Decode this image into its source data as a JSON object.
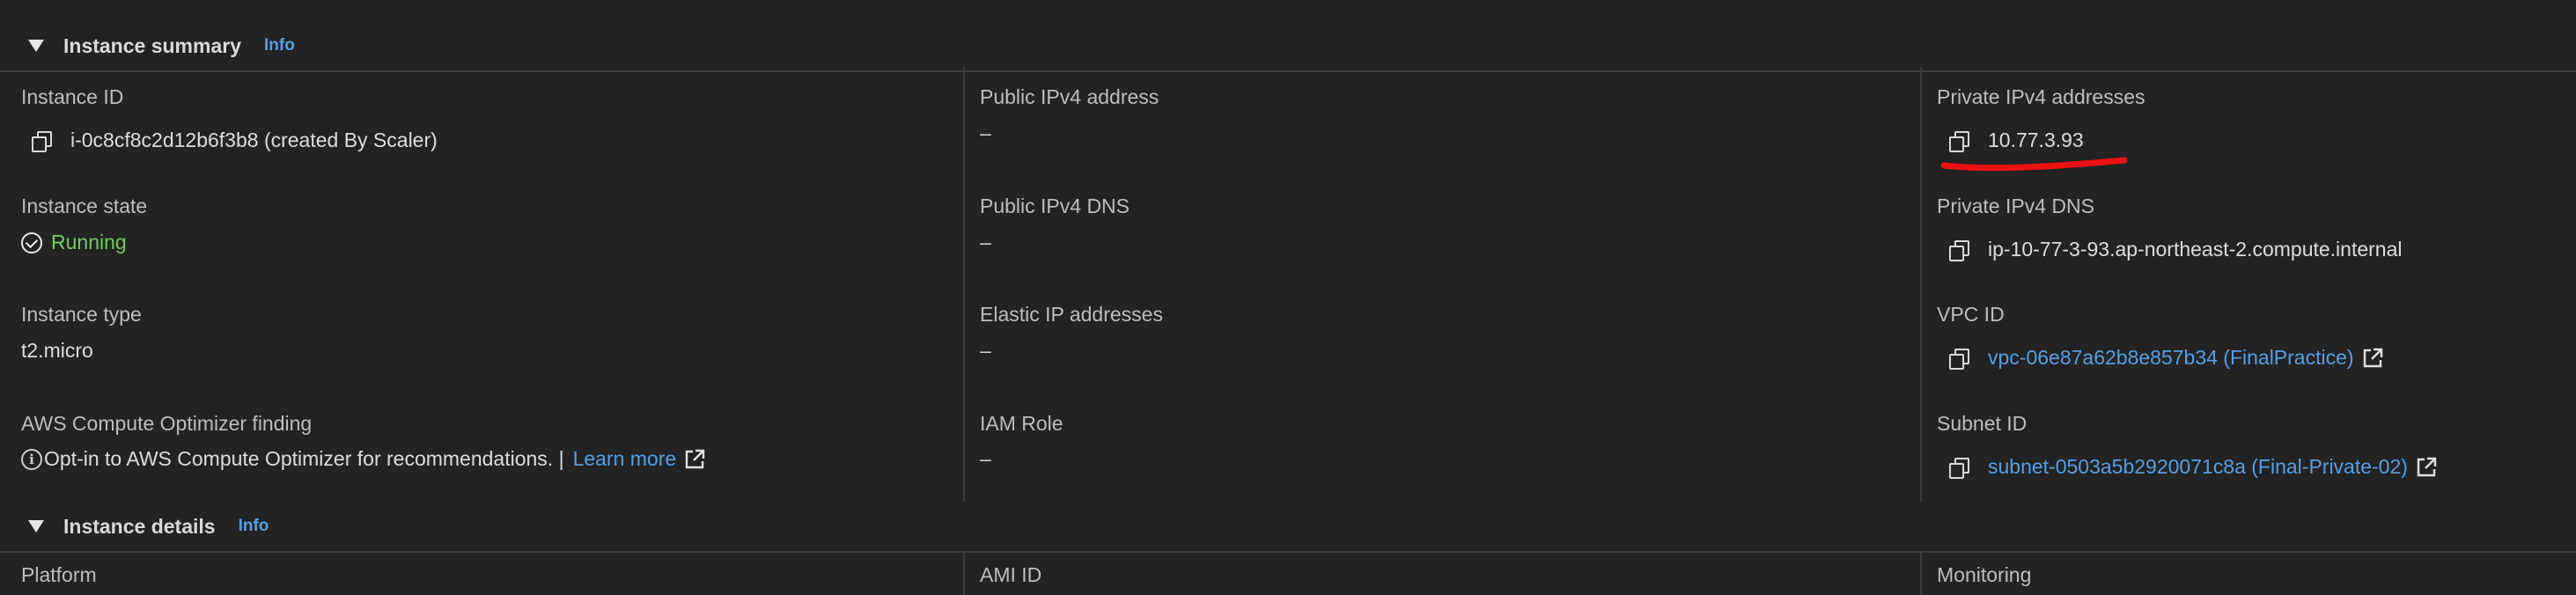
{
  "summary": {
    "title": "Instance summary",
    "info": "Info"
  },
  "col1": {
    "instance_id_label": "Instance ID",
    "instance_id_value": "i-0c8cf8c2d12b6f3b8 (created By Scaler)",
    "instance_state_label": "Instance state",
    "instance_state_value": "Running",
    "instance_type_label": "Instance type",
    "instance_type_value": "t2.micro",
    "optimizer_label": "AWS Compute Optimizer finding",
    "optimizer_text": "Opt-in to AWS Compute Optimizer for recommendations. |",
    "optimizer_link": "Learn more"
  },
  "col2": {
    "public_ipv4_label": "Public IPv4 address",
    "public_ipv4_value": "–",
    "public_dns_label": "Public IPv4 DNS",
    "public_dns_value": "–",
    "elastic_ip_label": "Elastic IP addresses",
    "elastic_ip_value": "–",
    "iam_role_label": "IAM Role",
    "iam_role_value": "–"
  },
  "col3": {
    "private_ipv4_label": "Private IPv4 addresses",
    "private_ipv4_value": "10.77.3.93",
    "private_dns_label": "Private IPv4 DNS",
    "private_dns_value": "ip-10-77-3-93.ap-northeast-2.compute.internal",
    "vpc_id_label": "VPC ID",
    "vpc_id_value": "vpc-06e87a62b8e857b34 (FinalPractice)",
    "subnet_id_label": "Subnet ID",
    "subnet_id_value": "subnet-0503a5b2920071c8a (Final-Private-02)"
  },
  "details": {
    "title": "Instance details",
    "info": "Info",
    "platform_label": "Platform",
    "ami_id_label": "AMI ID",
    "monitoring_label": "Monitoring"
  },
  "colors": {
    "background": "#232323",
    "link": "#539fe5",
    "running": "#6fce5b",
    "annotation": "#ee1111"
  }
}
